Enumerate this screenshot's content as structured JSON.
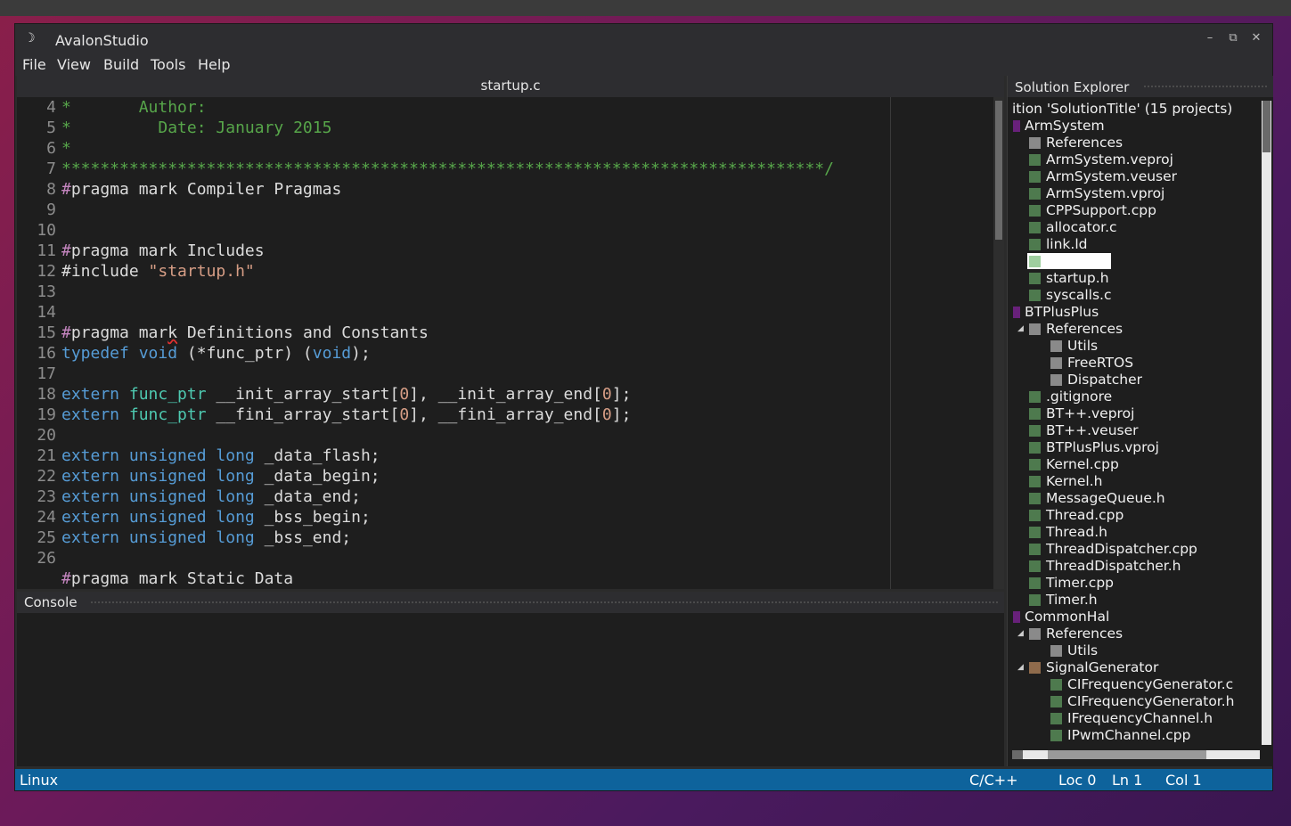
{
  "window": {
    "title": "AvalonStudio",
    "app_icon": "moon-icon",
    "controls": {
      "minimize": "–",
      "restore": "⧉",
      "close": "✕"
    }
  },
  "menu": [
    "File",
    "View",
    "Build",
    "Tools",
    "Help"
  ],
  "editor": {
    "tab_title": "startup.c",
    "line_numbers": [
      "4",
      "5",
      "6",
      "7",
      "8",
      "9",
      "10",
      "11",
      "12",
      "13",
      "14",
      "15",
      "16",
      "17",
      "18",
      "19",
      "20",
      "21",
      "22",
      "23",
      "24",
      "25",
      "26",
      ""
    ],
    "lines": [
      [
        {
          "t": "*       Author:",
          "c": "c-green"
        }
      ],
      [
        {
          "t": "*         Date: January 2015",
          "c": "c-green"
        }
      ],
      [
        {
          "t": "*",
          "c": "c-green"
        }
      ],
      [
        {
          "t": "*******************************************************************************/",
          "c": "c-green"
        }
      ],
      [
        {
          "t": "#",
          "c": "c-purple"
        },
        {
          "t": "pragma mark Compiler Pragmas",
          "c": ""
        }
      ],
      [],
      [],
      [
        {
          "t": "#",
          "c": "c-purple"
        },
        {
          "t": "pragma mark Includes",
          "c": ""
        }
      ],
      [
        {
          "t": "#include ",
          "c": ""
        },
        {
          "t": "\"startup.h\"",
          "c": "c-orange"
        }
      ],
      [],
      [],
      [
        {
          "t": "#",
          "c": "c-purple"
        },
        {
          "t": "pragma mar",
          "c": ""
        },
        {
          "t": "k",
          "c": "squiggle"
        },
        {
          "t": " Definitions and Constants",
          "c": ""
        }
      ],
      [
        {
          "t": "typedef ",
          "c": "c-blue"
        },
        {
          "t": "void ",
          "c": "c-blue"
        },
        {
          "t": "(*func_ptr) (",
          "c": ""
        },
        {
          "t": "void",
          "c": "c-blue"
        },
        {
          "t": ");",
          "c": ""
        }
      ],
      [],
      [
        {
          "t": "extern ",
          "c": "c-blue"
        },
        {
          "t": "func_ptr ",
          "c": "c-teal"
        },
        {
          "t": "__init_array_start[",
          "c": ""
        },
        {
          "t": "0",
          "c": "c-orange"
        },
        {
          "t": "], __init_array_end[",
          "c": ""
        },
        {
          "t": "0",
          "c": "c-orange"
        },
        {
          "t": "];",
          "c": ""
        }
      ],
      [
        {
          "t": "extern ",
          "c": "c-blue"
        },
        {
          "t": "func_ptr ",
          "c": "c-teal"
        },
        {
          "t": "__fini_array_start[",
          "c": ""
        },
        {
          "t": "0",
          "c": "c-orange"
        },
        {
          "t": "], __fini_array_end[",
          "c": ""
        },
        {
          "t": "0",
          "c": "c-orange"
        },
        {
          "t": "];",
          "c": ""
        }
      ],
      [],
      [
        {
          "t": "extern ",
          "c": "c-blue"
        },
        {
          "t": "unsigned ",
          "c": "c-blue"
        },
        {
          "t": "long ",
          "c": "c-blue"
        },
        {
          "t": "_data_flash;",
          "c": ""
        }
      ],
      [
        {
          "t": "extern ",
          "c": "c-blue"
        },
        {
          "t": "unsigned ",
          "c": "c-blue"
        },
        {
          "t": "long ",
          "c": "c-blue"
        },
        {
          "t": "_data_begin;",
          "c": ""
        }
      ],
      [
        {
          "t": "extern ",
          "c": "c-blue"
        },
        {
          "t": "unsigned ",
          "c": "c-blue"
        },
        {
          "t": "long ",
          "c": "c-blue"
        },
        {
          "t": "_data_end;",
          "c": ""
        }
      ],
      [
        {
          "t": "extern ",
          "c": "c-blue"
        },
        {
          "t": "unsigned ",
          "c": "c-blue"
        },
        {
          "t": "long ",
          "c": "c-blue"
        },
        {
          "t": "_bss_begin;",
          "c": ""
        }
      ],
      [
        {
          "t": "extern ",
          "c": "c-blue"
        },
        {
          "t": "unsigned ",
          "c": "c-blue"
        },
        {
          "t": "long ",
          "c": "c-blue"
        },
        {
          "t": "_bss_end;",
          "c": ""
        }
      ],
      [],
      [
        {
          "t": "#",
          "c": "c-purple"
        },
        {
          "t": "pragma mark Static Data",
          "c": ""
        }
      ]
    ]
  },
  "console": {
    "title": "Console"
  },
  "solution_explorer": {
    "title": "Solution Explorer",
    "items": [
      {
        "label": "ition 'SolutionTitle' (15 projects)",
        "indent": 0,
        "icon": "none",
        "expand": ""
      },
      {
        "label": "ArmSystem",
        "indent": 0,
        "icon": "purple",
        "expand": ""
      },
      {
        "label": "References",
        "indent": 1,
        "icon": "gray",
        "expand": ""
      },
      {
        "label": "ArmSystem.veproj",
        "indent": 1,
        "icon": "green",
        "expand": ""
      },
      {
        "label": "ArmSystem.veuser",
        "indent": 1,
        "icon": "green",
        "expand": ""
      },
      {
        "label": "ArmSystem.vproj",
        "indent": 1,
        "icon": "green",
        "expand": ""
      },
      {
        "label": "CPPSupport.cpp",
        "indent": 1,
        "icon": "green",
        "expand": ""
      },
      {
        "label": "allocator.c",
        "indent": 1,
        "icon": "green",
        "expand": ""
      },
      {
        "label": "link.ld",
        "indent": 1,
        "icon": "green",
        "expand": ""
      },
      {
        "label": "",
        "indent": 1,
        "icon": "selected",
        "expand": ""
      },
      {
        "label": "startup.h",
        "indent": 1,
        "icon": "green",
        "expand": ""
      },
      {
        "label": "syscalls.c",
        "indent": 1,
        "icon": "green",
        "expand": ""
      },
      {
        "label": "BTPlusPlus",
        "indent": 0,
        "icon": "purple",
        "expand": ""
      },
      {
        "label": "References",
        "indent": 1,
        "icon": "gray",
        "expand": "◢"
      },
      {
        "label": "Utils",
        "indent": 2,
        "icon": "gray",
        "expand": ""
      },
      {
        "label": "FreeRTOS",
        "indent": 2,
        "icon": "gray",
        "expand": ""
      },
      {
        "label": "Dispatcher",
        "indent": 2,
        "icon": "gray",
        "expand": ""
      },
      {
        "label": ".gitignore",
        "indent": 1,
        "icon": "green",
        "expand": ""
      },
      {
        "label": "BT++.veproj",
        "indent": 1,
        "icon": "green",
        "expand": ""
      },
      {
        "label": "BT++.veuser",
        "indent": 1,
        "icon": "green",
        "expand": ""
      },
      {
        "label": "BTPlusPlus.vproj",
        "indent": 1,
        "icon": "green",
        "expand": ""
      },
      {
        "label": "Kernel.cpp",
        "indent": 1,
        "icon": "green",
        "expand": ""
      },
      {
        "label": "Kernel.h",
        "indent": 1,
        "icon": "green",
        "expand": ""
      },
      {
        "label": "MessageQueue.h",
        "indent": 1,
        "icon": "green",
        "expand": ""
      },
      {
        "label": "Thread.cpp",
        "indent": 1,
        "icon": "green",
        "expand": ""
      },
      {
        "label": "Thread.h",
        "indent": 1,
        "icon": "green",
        "expand": ""
      },
      {
        "label": "ThreadDispatcher.cpp",
        "indent": 1,
        "icon": "green",
        "expand": ""
      },
      {
        "label": "ThreadDispatcher.h",
        "indent": 1,
        "icon": "green",
        "expand": ""
      },
      {
        "label": "Timer.cpp",
        "indent": 1,
        "icon": "green",
        "expand": ""
      },
      {
        "label": "Timer.h",
        "indent": 1,
        "icon": "green",
        "expand": ""
      },
      {
        "label": "CommonHal",
        "indent": 0,
        "icon": "purple",
        "expand": ""
      },
      {
        "label": "References",
        "indent": 1,
        "icon": "gray",
        "expand": "◢"
      },
      {
        "label": "Utils",
        "indent": 2,
        "icon": "gray",
        "expand": ""
      },
      {
        "label": "SignalGenerator",
        "indent": 1,
        "icon": "brown",
        "expand": "◢"
      },
      {
        "label": "CIFrequencyGenerator.c",
        "indent": 2,
        "icon": "green",
        "expand": ""
      },
      {
        "label": "CIFrequencyGenerator.h",
        "indent": 2,
        "icon": "green",
        "expand": ""
      },
      {
        "label": "IFrequencyChannel.h",
        "indent": 2,
        "icon": "green",
        "expand": ""
      },
      {
        "label": "IPwmChannel.cpp",
        "indent": 2,
        "icon": "green",
        "expand": ""
      }
    ]
  },
  "status": {
    "platform": "Linux",
    "language": "C/C++",
    "loc": "Loc 0",
    "line": "Ln 1",
    "col": "Col 1"
  }
}
